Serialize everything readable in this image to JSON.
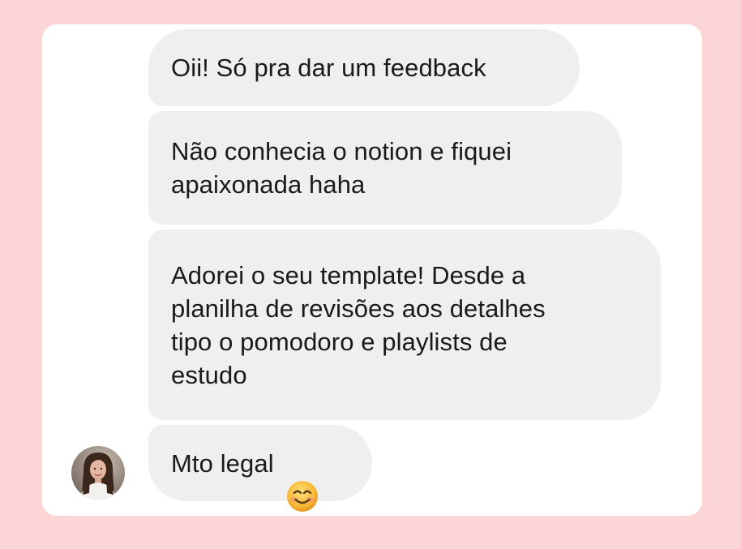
{
  "messages": [
    {
      "text": "Oii! Só pra dar um feedback"
    },
    {
      "text": "Não conhecia o notion e fiquei\napaixonada haha"
    },
    {
      "text": "Adorei o seu template! Desde a\nplanilha de revisões aos detalhes\ntipo o pomodoro e playlists de\nestudo"
    },
    {
      "text": "Mto legal",
      "emoji": "smiling-face-icon"
    }
  ],
  "colors": {
    "page_background": "#fcd5d6",
    "card_background": "#ffffff",
    "bubble_background": "#efefef",
    "text": "#1a1a1a",
    "emoji_face": "#f7b733"
  },
  "avatar": {
    "icon": "person-avatar-icon"
  }
}
